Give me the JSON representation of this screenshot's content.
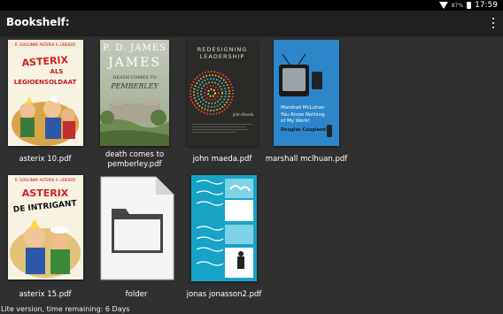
{
  "status": {
    "battery": "87%",
    "time": "17:59"
  },
  "appbar": {
    "title": "Bookshelf:"
  },
  "books": [
    {
      "label": "asterix 10.pdf",
      "cover": {
        "header": "R. GOSCINNY ASTERIX A. UDERZO",
        "title": "ASTERIX ALS LEGIOENSOLDAAT"
      }
    },
    {
      "label": "death comes to pemberley.pdf",
      "cover": {
        "author": "P. D. JAMES",
        "title1": "DEATH COMES TO",
        "title2": "PEMBERLEY"
      }
    },
    {
      "label": "john maeda.pdf",
      "cover": {
        "title1": "REDESIGNING",
        "title2": "LEADERSHIP",
        "author": "John Maeda"
      }
    },
    {
      "label": "marshall mclhuan.pdf",
      "cover": {
        "line1": "Marshall McLuhan",
        "line2": "You Know Nothing",
        "line3": "of My Work!",
        "line4": "Douglas Coupland"
      }
    },
    {
      "label": "asterix 15.pdf",
      "cover": {
        "header": "R. GOSCINNY ASTERIX A. UDERZO",
        "title": "DE INTRIGANT"
      }
    },
    {
      "label": "folder"
    },
    {
      "label": "jonas jonasson2.pdf"
    }
  ],
  "footer": {
    "text": "Lite version, time remaining: 6 Days"
  },
  "colors": {
    "background": "#303030",
    "appbar": "#212121",
    "statusbar": "#000000"
  }
}
